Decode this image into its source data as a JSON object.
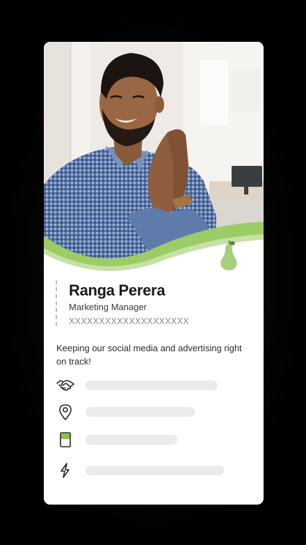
{
  "profile": {
    "name": "Ranga Perera",
    "role": "Marketing Manager",
    "id_number": "XXXXXXXXXXXXXXXXXXXX",
    "bio": "Keeping our social media and advertising right on track!"
  },
  "contact_rows": [
    {
      "icon": "handshake-icon"
    },
    {
      "icon": "location-pin-icon"
    },
    {
      "icon": "id-card-icon"
    },
    {
      "icon": "lightning-icon"
    }
  ],
  "colors": {
    "accent_green": "#9ccc65",
    "wave_light": "#c5e1a5",
    "pear_green": "#a5cf7a",
    "pear_stem": "#4e8b3a",
    "placeholder_bar": "#ebebeb",
    "text_dark": "#1b1b1b"
  }
}
